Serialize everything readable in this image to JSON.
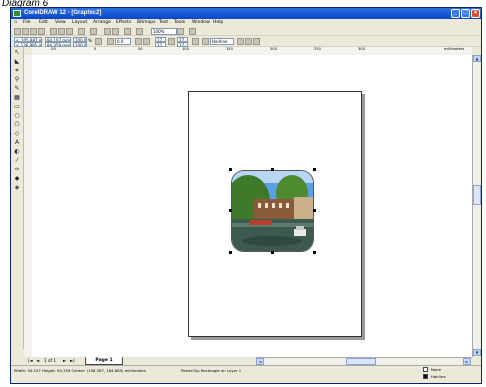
{
  "caption": "Diagram 6",
  "window": {
    "title": "CorelDRAW 12 - [Graphic2]",
    "controls": [
      "_",
      "□",
      "×"
    ]
  },
  "menu": [
    "File",
    "Edit",
    "View",
    "Layout",
    "Arrange",
    "Effects",
    "Bitmaps",
    "Text",
    "Tools",
    "Window",
    "Help"
  ],
  "standard_toolbar": {
    "zoom_level": "100%"
  },
  "property_bar": {
    "x": "x: 105.987 mm",
    "y": "y: 136.995 mm",
    "width": "94.107 mm",
    "height": "94.359 mm",
    "scale_x": "100.0",
    "scale_y": "100.0",
    "pct": "%",
    "angle": "0.0",
    "corner_a": "27",
    "corner_b": "27",
    "corner_c": "27",
    "corner_d": "27",
    "outline": "Hairline"
  },
  "ruler": {
    "ticks": [
      "-50",
      "0",
      "50",
      "100",
      "150",
      "200",
      "250",
      "300",
      "millimeters"
    ]
  },
  "page_nav": {
    "counter": "1 of 1",
    "tab": "Page 1"
  },
  "status": {
    "dimensions": "Width: 94.107  Height: 94.359  Center: (158.387, 184.885)  millimeters",
    "object": "PowerClip Rectangle on Layer 1",
    "fill": "None",
    "outline": "Hairline"
  },
  "colors": {
    "titlebar": "#0a47c7",
    "chrome": "#ece9d8",
    "photo_sky": "#5aa0e6",
    "photo_water": "#3d5a4e"
  }
}
